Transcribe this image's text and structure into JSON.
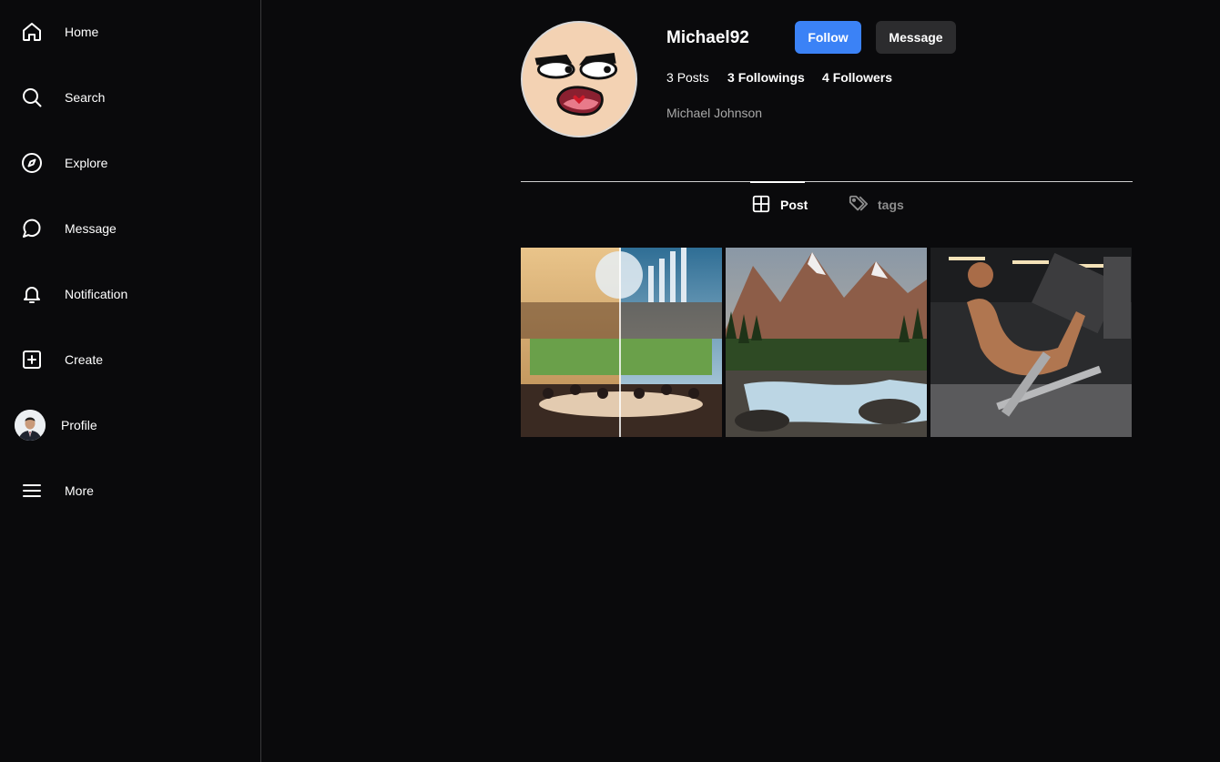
{
  "sidebar": {
    "items": [
      {
        "label": "Home",
        "icon": "home-icon"
      },
      {
        "label": "Search",
        "icon": "search-icon"
      },
      {
        "label": "Explore",
        "icon": "compass-icon"
      },
      {
        "label": "Message",
        "icon": "chat-bubble-icon"
      },
      {
        "label": "Notification",
        "icon": "bell-icon"
      },
      {
        "label": "Create",
        "icon": "plus-square-icon"
      },
      {
        "label": "Profile",
        "icon": "avatar"
      },
      {
        "label": "More",
        "icon": "hamburger-icon"
      }
    ]
  },
  "profile": {
    "username": "Michael92",
    "follow_label": "Follow",
    "message_label": "Message",
    "posts_count": "3",
    "posts_label": "Posts",
    "followings_count": "3",
    "followings_label": "Followings",
    "followers_count": "4",
    "followers_label": "Followers",
    "full_name": "Michael Johnson"
  },
  "tabs": [
    {
      "label": "Post",
      "icon": "grid-icon",
      "active": true
    },
    {
      "label": "tags",
      "icon": "tag-icon",
      "active": false
    }
  ],
  "colors": {
    "background": "#0a0a0c",
    "accent": "#3b82f6",
    "secondary_button": "#2c2c2e",
    "muted_text": "#a8a8a8"
  }
}
